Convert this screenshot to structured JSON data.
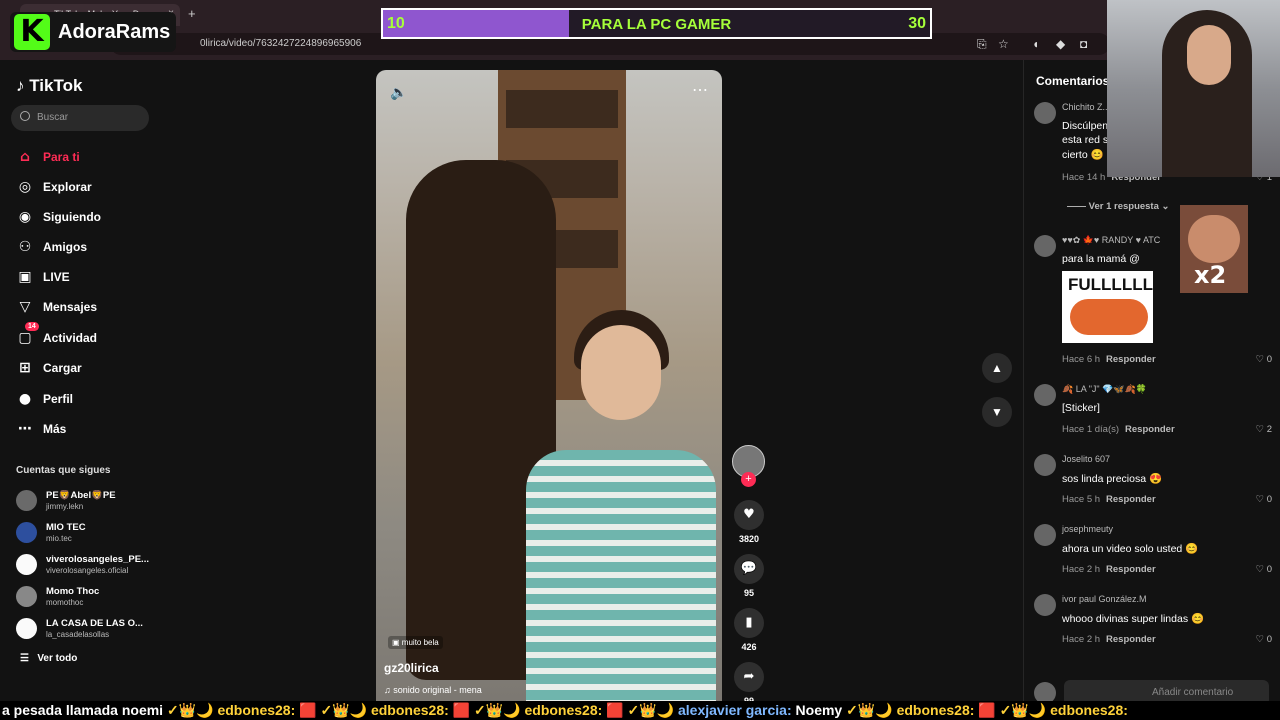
{
  "browser": {
    "tab_title": "TikTok - Make Your Day",
    "tab_close": "×",
    "new_tab": "+",
    "url": "0lirica/video/7632427224896965906"
  },
  "overlay": {
    "brand_logo": "K",
    "brand_name": "AdoraRams",
    "goal": {
      "start": "10",
      "title": "PARA LA PC GAMER",
      "end": "30",
      "progress": 0.34
    },
    "meme_label": "x2"
  },
  "sidebar": {
    "logo": "TikTok",
    "search_placeholder": "Buscar",
    "nav": [
      {
        "label": "Para ti",
        "icon": "home-icon",
        "glyph": "⌂"
      },
      {
        "label": "Explorar",
        "icon": "compass-icon",
        "glyph": "◎"
      },
      {
        "label": "Siguiendo",
        "icon": "following-icon",
        "glyph": "◉"
      },
      {
        "label": "Amigos",
        "icon": "friends-icon",
        "glyph": "⚇"
      },
      {
        "label": "LIVE",
        "icon": "live-icon",
        "glyph": "▣"
      },
      {
        "label": "Mensajes",
        "icon": "messages-icon",
        "glyph": "▽"
      },
      {
        "label": "Actividad",
        "icon": "activity-icon",
        "glyph": "▢",
        "badge": "14"
      },
      {
        "label": "Cargar",
        "icon": "upload-icon",
        "glyph": "⊞"
      },
      {
        "label": "Perfil",
        "icon": "profile-icon",
        "glyph": "●"
      },
      {
        "label": "Más",
        "icon": "more-icon",
        "glyph": "⋯"
      }
    ],
    "following_header": "Cuentas que sigues",
    "accounts": [
      {
        "name": "PE🦁Abel🦁PE",
        "handle": "jimmy.lekn"
      },
      {
        "name": "MIO TEC",
        "handle": "mio.tec"
      },
      {
        "name": "viverolosangeles_PE...",
        "handle": "viverolosangeles.oficial"
      },
      {
        "name": "Momo Thoc",
        "handle": "momothoc"
      },
      {
        "name": "LA CASA DE LAS O...",
        "handle": "la_casadelasollas"
      }
    ],
    "see_all": "Ver todo"
  },
  "video": {
    "tag": "muito bela",
    "author": "gz20lirica",
    "sound": "sonido original - mena"
  },
  "actions": {
    "likes": "3820",
    "comments": "95",
    "saves": "426",
    "shares": "99"
  },
  "comments": {
    "title": "Comentarios",
    "reply_label": "Responder",
    "view_replies": "Ver 1 respuesta",
    "input_placeholder": "Añadir comentario",
    "items": [
      {
        "user": "Chichito Z...",
        "text": "Discúlpen...",
        "text2": "esta red s...",
        "text3": "cierto 😊",
        "time": "Hace 14 h",
        "likes": "1"
      },
      {
        "user": "♥♥✿ 🍁♥ RANDY ♥ ATC",
        "text": "para la mamá @",
        "sticker": "FULLLLLL",
        "time": "Hace 6 h",
        "likes": "0"
      },
      {
        "user": "🍂 LA \"J\" 💎🦋🍂🍀",
        "text": "[Sticker]",
        "time": "Hace 1 día(s)",
        "likes": "2"
      },
      {
        "user": "Joselito 607",
        "text": "sos linda preciosa 😍",
        "time": "Hace 5 h",
        "likes": "0"
      },
      {
        "user": "josephmeuty",
        "text": "ahora un video solo usted 😊",
        "time": "Hace 2 h",
        "likes": "0"
      },
      {
        "user": "ivor paul González.M",
        "text": "whooo divinas super lindas 😊",
        "time": "Hace 2 h",
        "likes": "0"
      }
    ]
  },
  "ticker": {
    "items": [
      {
        "text": "a pesada llamada noemi",
        "color": "white"
      },
      {
        "text": " ✓👑🌙 ",
        "color": "emo"
      },
      {
        "text": "edbones28:",
        "color": "yellow"
      },
      {
        "text": " 🟥 ✓👑🌙 ",
        "color": "emo"
      },
      {
        "text": "edbones28:",
        "color": "yellow"
      },
      {
        "text": " 🟥 ✓👑🌙 ",
        "color": "emo"
      },
      {
        "text": "edbones28:",
        "color": "yellow"
      },
      {
        "text": " 🟥 ✓👑🌙 ",
        "color": "emo"
      },
      {
        "text": "alexjavier garcia:",
        "color": "blue"
      },
      {
        "text": " Noemy ",
        "color": "white"
      },
      {
        "text": " ✓👑🌙 ",
        "color": "emo"
      },
      {
        "text": "edbones28:",
        "color": "yellow"
      },
      {
        "text": " 🟥 ✓👑🌙 ",
        "color": "emo"
      },
      {
        "text": "edbones28:",
        "color": "yellow"
      }
    ]
  },
  "colors": {
    "accent": "#fe2c55",
    "goal_fill": "#8f56cf",
    "goal_text": "#a6ff3a",
    "kick": "#53fc18"
  }
}
